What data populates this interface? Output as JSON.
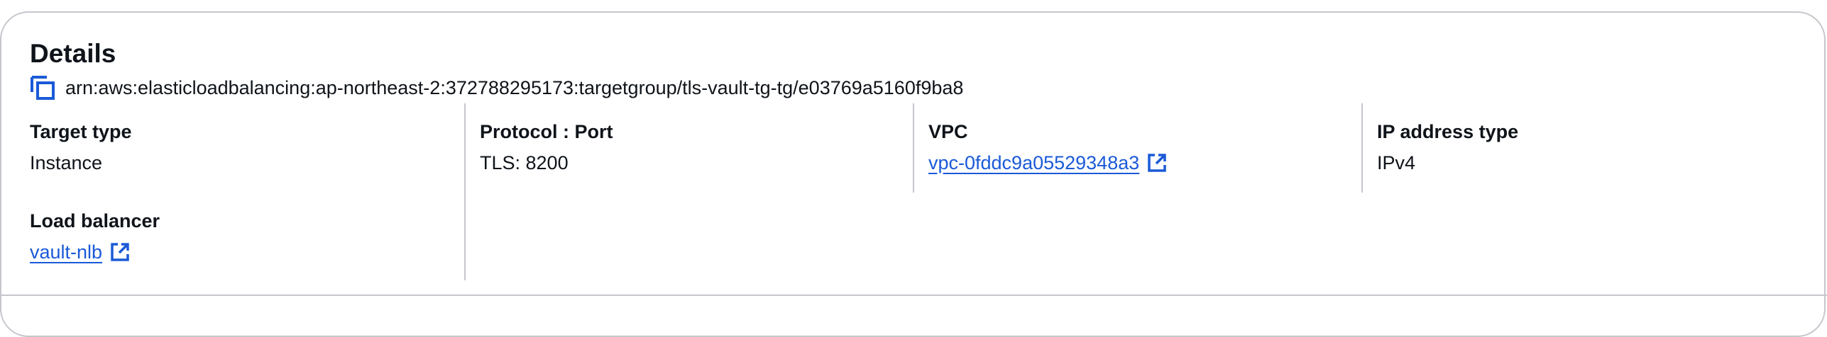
{
  "details": {
    "title": "Details",
    "arn": "arn:aws:elasticloadbalancing:ap-northeast-2:372788295173:targetgroup/tls-vault-tg-tg/e03769a5160f9ba8"
  },
  "fields": {
    "target_type": {
      "label": "Target type",
      "value": "Instance"
    },
    "protocol_port": {
      "label": "Protocol : Port",
      "value": "TLS: 8200"
    },
    "vpc": {
      "label": "VPC",
      "value": "vpc-0fddc9a05529348a3"
    },
    "ip_address_type": {
      "label": "IP address type",
      "value": "IPv4"
    },
    "load_balancer": {
      "label": "Load balancer",
      "value": "vault-nlb"
    }
  },
  "icons": {
    "copy": "copy-icon",
    "external_link": "external-link-icon"
  },
  "colors": {
    "link": "#1a5ad8",
    "text": "#0f141a",
    "border": "#c6c6cd"
  }
}
